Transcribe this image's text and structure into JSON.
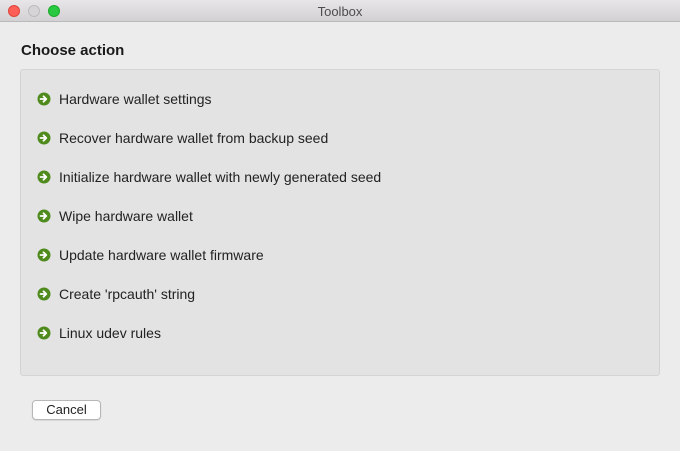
{
  "window": {
    "title": "Toolbox"
  },
  "heading": "Choose action",
  "actions": [
    {
      "label": "Hardware wallet settings",
      "icon": "arrow-right-circle-icon"
    },
    {
      "label": "Recover hardware wallet from backup seed",
      "icon": "arrow-right-circle-icon"
    },
    {
      "label": "Initialize hardware wallet with newly generated seed",
      "icon": "arrow-right-circle-icon"
    },
    {
      "label": "Wipe hardware wallet",
      "icon": "arrow-right-circle-icon"
    },
    {
      "label": "Update hardware wallet firmware",
      "icon": "arrow-right-circle-icon"
    },
    {
      "label": "Create 'rpcauth' string",
      "icon": "arrow-right-circle-icon"
    },
    {
      "label": "Linux udev rules",
      "icon": "arrow-right-circle-icon"
    }
  ],
  "buttons": {
    "cancel": "Cancel"
  },
  "colors": {
    "icon_green": "#4e8a1c",
    "close": "#fe5f57",
    "zoom": "#28c840"
  }
}
